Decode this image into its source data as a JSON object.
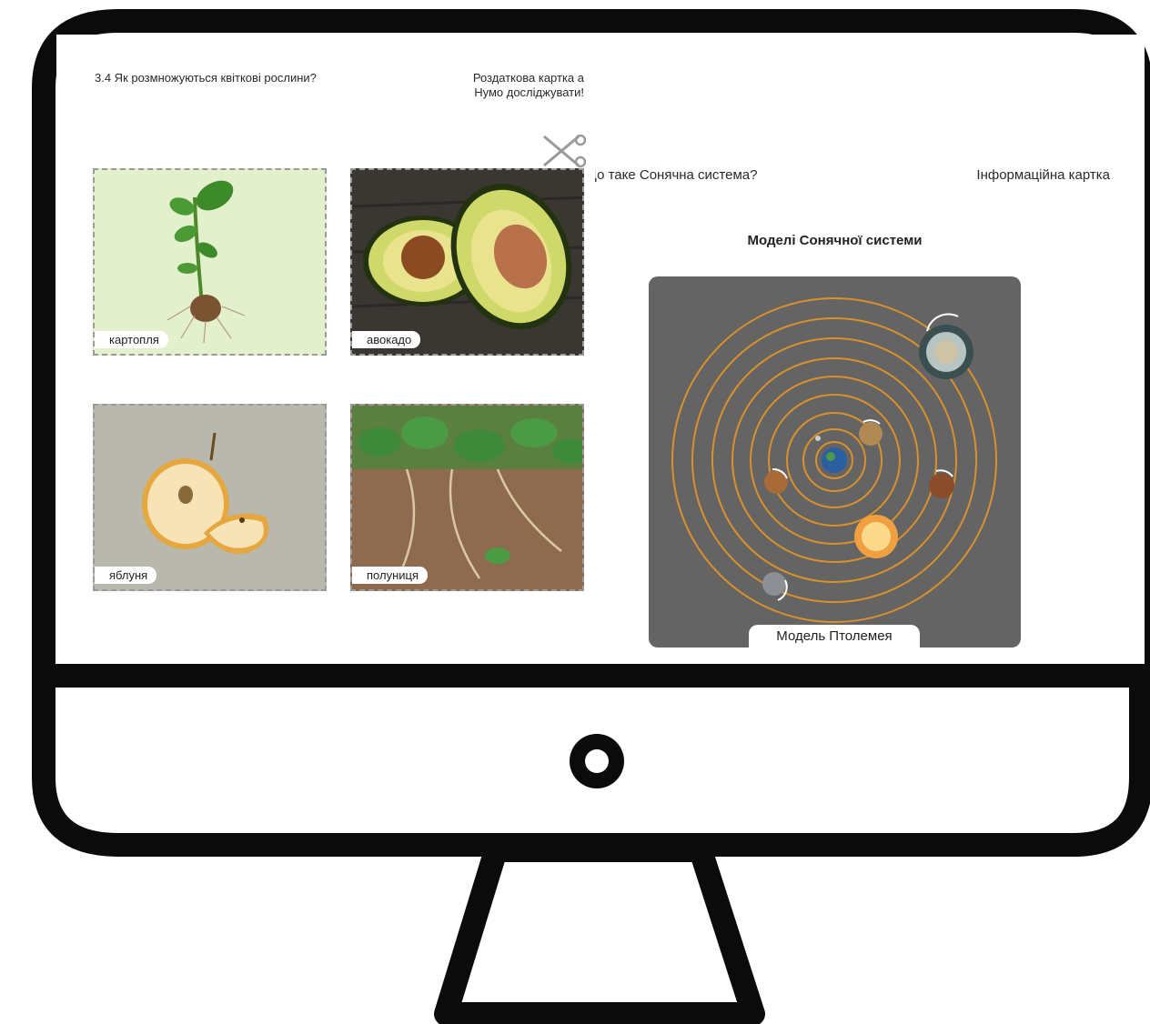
{
  "lesson": {
    "title": "3.4 Як розмножуються квіткові рослини?",
    "card_type_line1": "Роздаткова  картка а",
    "card_type_line2": "Нумо досліджувати!"
  },
  "cards": [
    {
      "label": "картопля"
    },
    {
      "label": "авокадо"
    },
    {
      "label": "яблуня"
    },
    {
      "label": "полуниця"
    }
  ],
  "info": {
    "title": "Що таке Сонячна система?",
    "card_type": "Інформаційна картка",
    "heading": "Моделі Сонячної системи",
    "model_caption": "Модель Птолемея"
  },
  "colors": {
    "frame": "#0b0b0b",
    "model_bg": "#646464",
    "orbit": "#d9912b",
    "potato_bg": "#e3f0cc",
    "apple_bg": "#b9b8ad"
  },
  "icons": [
    "scissors-icon",
    "power-button-icon"
  ]
}
